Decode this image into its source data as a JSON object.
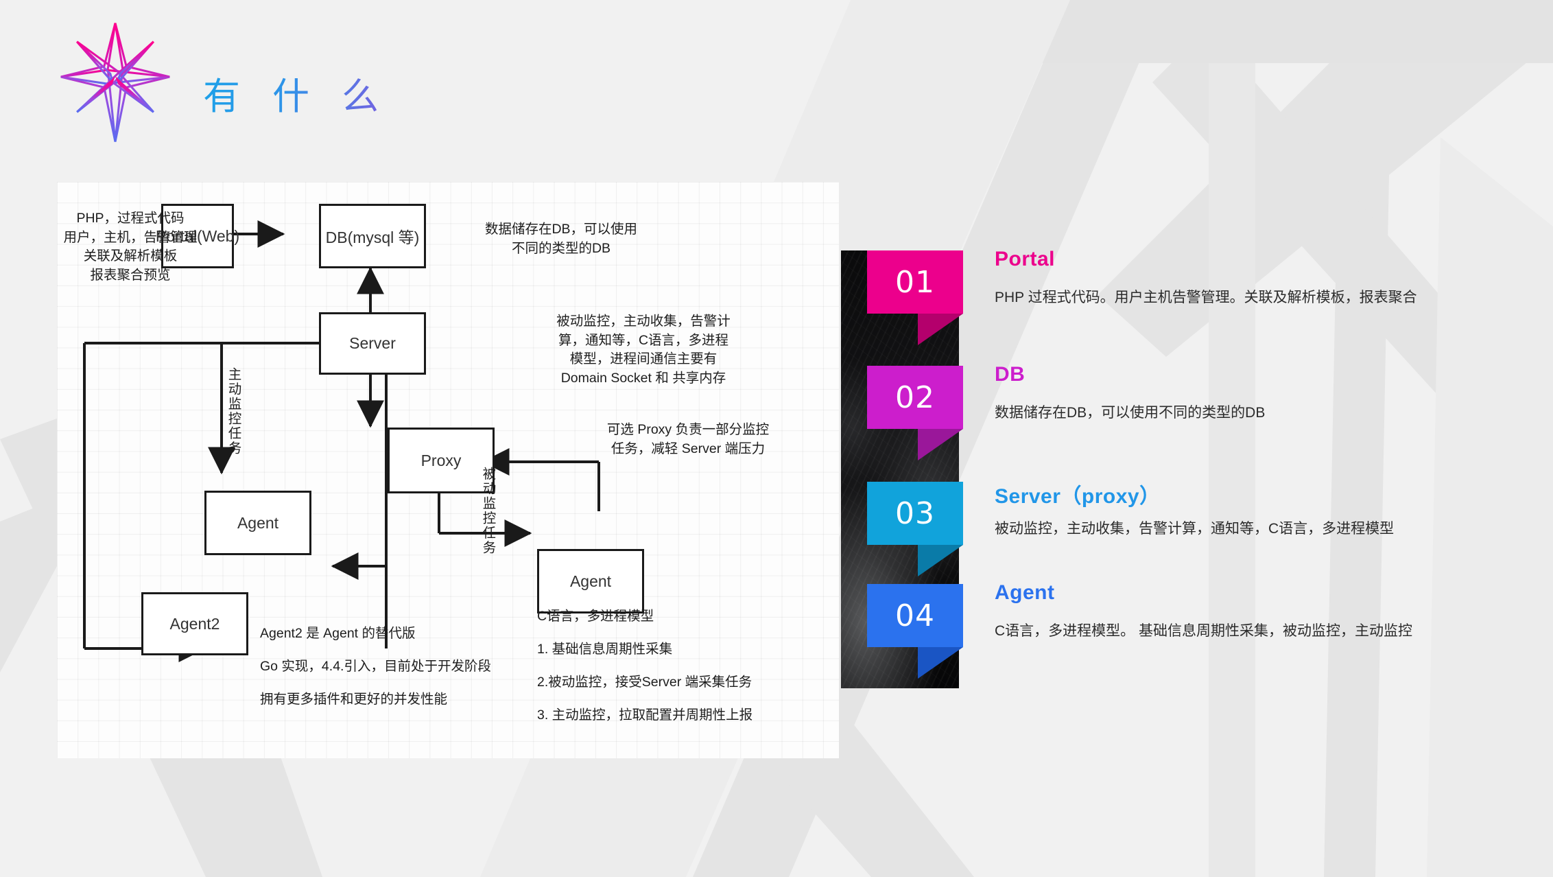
{
  "header": {
    "title": "有 什 么",
    "logo_icon": "eight-point-star-logo"
  },
  "diagram": {
    "boxes": [
      {
        "id": "portal",
        "label": "Portal(Web)"
      },
      {
        "id": "db",
        "label": "DB(mysql 等)"
      },
      {
        "id": "server",
        "label": "Server"
      },
      {
        "id": "proxy",
        "label": "Proxy"
      },
      {
        "id": "agent",
        "label": "Agent"
      },
      {
        "id": "agent_right",
        "label": "Agent"
      },
      {
        "id": "agent2",
        "label": "Agent2"
      }
    ],
    "notes": {
      "portal": "PHP，过程式代码\n用户，主机，告警管理\n关联及解析模板\n报表聚合预览",
      "db": "数据储存在DB，可以使用\n不同的类型的DB",
      "server": "被动监控，主动收集，告警计\n算，通知等，C语言，多进程\n模型，进程间通信主要有\nDomain Socket 和 共享内存",
      "proxy": "可选 Proxy 负责一部分监控\n任务，减轻 Server 端压力",
      "agent2_line1": "Agent2 是 Agent 的替代版",
      "agent2_line2": "Go 实现，4.4.引入，目前处于开发阶段",
      "agent2_line3": "拥有更多插件和更好的并发性能",
      "agent_line1": "C语言，多进程模型",
      "agent_line2": "1. 基础信息周期性采集",
      "agent_line3": "2.被动监控，接受Server 端采集任务",
      "agent_line4": "3. 主动监控，拉取配置并周期性上报"
    },
    "edge_labels": {
      "active": "主动监控任务",
      "passive": "被动监控任务"
    }
  },
  "list": {
    "items": [
      {
        "number": "01",
        "title": "Portal",
        "desc": "PHP 过程式代码。用户主机告警管理。关联及解析模板，报表聚合",
        "color": "#EC008C",
        "fold_color": "#B4006C",
        "title_color": "#EC008C"
      },
      {
        "number": "02",
        "title": "DB",
        "desc": "数据储存在DB，可以使用不同的类型的DB",
        "color": "#CC1ECC",
        "fold_color": "#9A179A",
        "title_color": "#CC1ECC"
      },
      {
        "number": "03",
        "title": "Server（proxy）",
        "desc": "被动监控，主动收集，告警计算，通知等，C语言，多进程模型",
        "color": "#11A3DB",
        "fold_color": "#0A7BA8",
        "title_color": "#2196E8"
      },
      {
        "number": "04",
        "title": "Agent",
        "desc": "C语言，多进程模型。 基础信息周期性采集，被动监控，主动监控",
        "color": "#2B72EE",
        "fold_color": "#1A55C4",
        "title_color": "#2B72EE"
      }
    ]
  }
}
